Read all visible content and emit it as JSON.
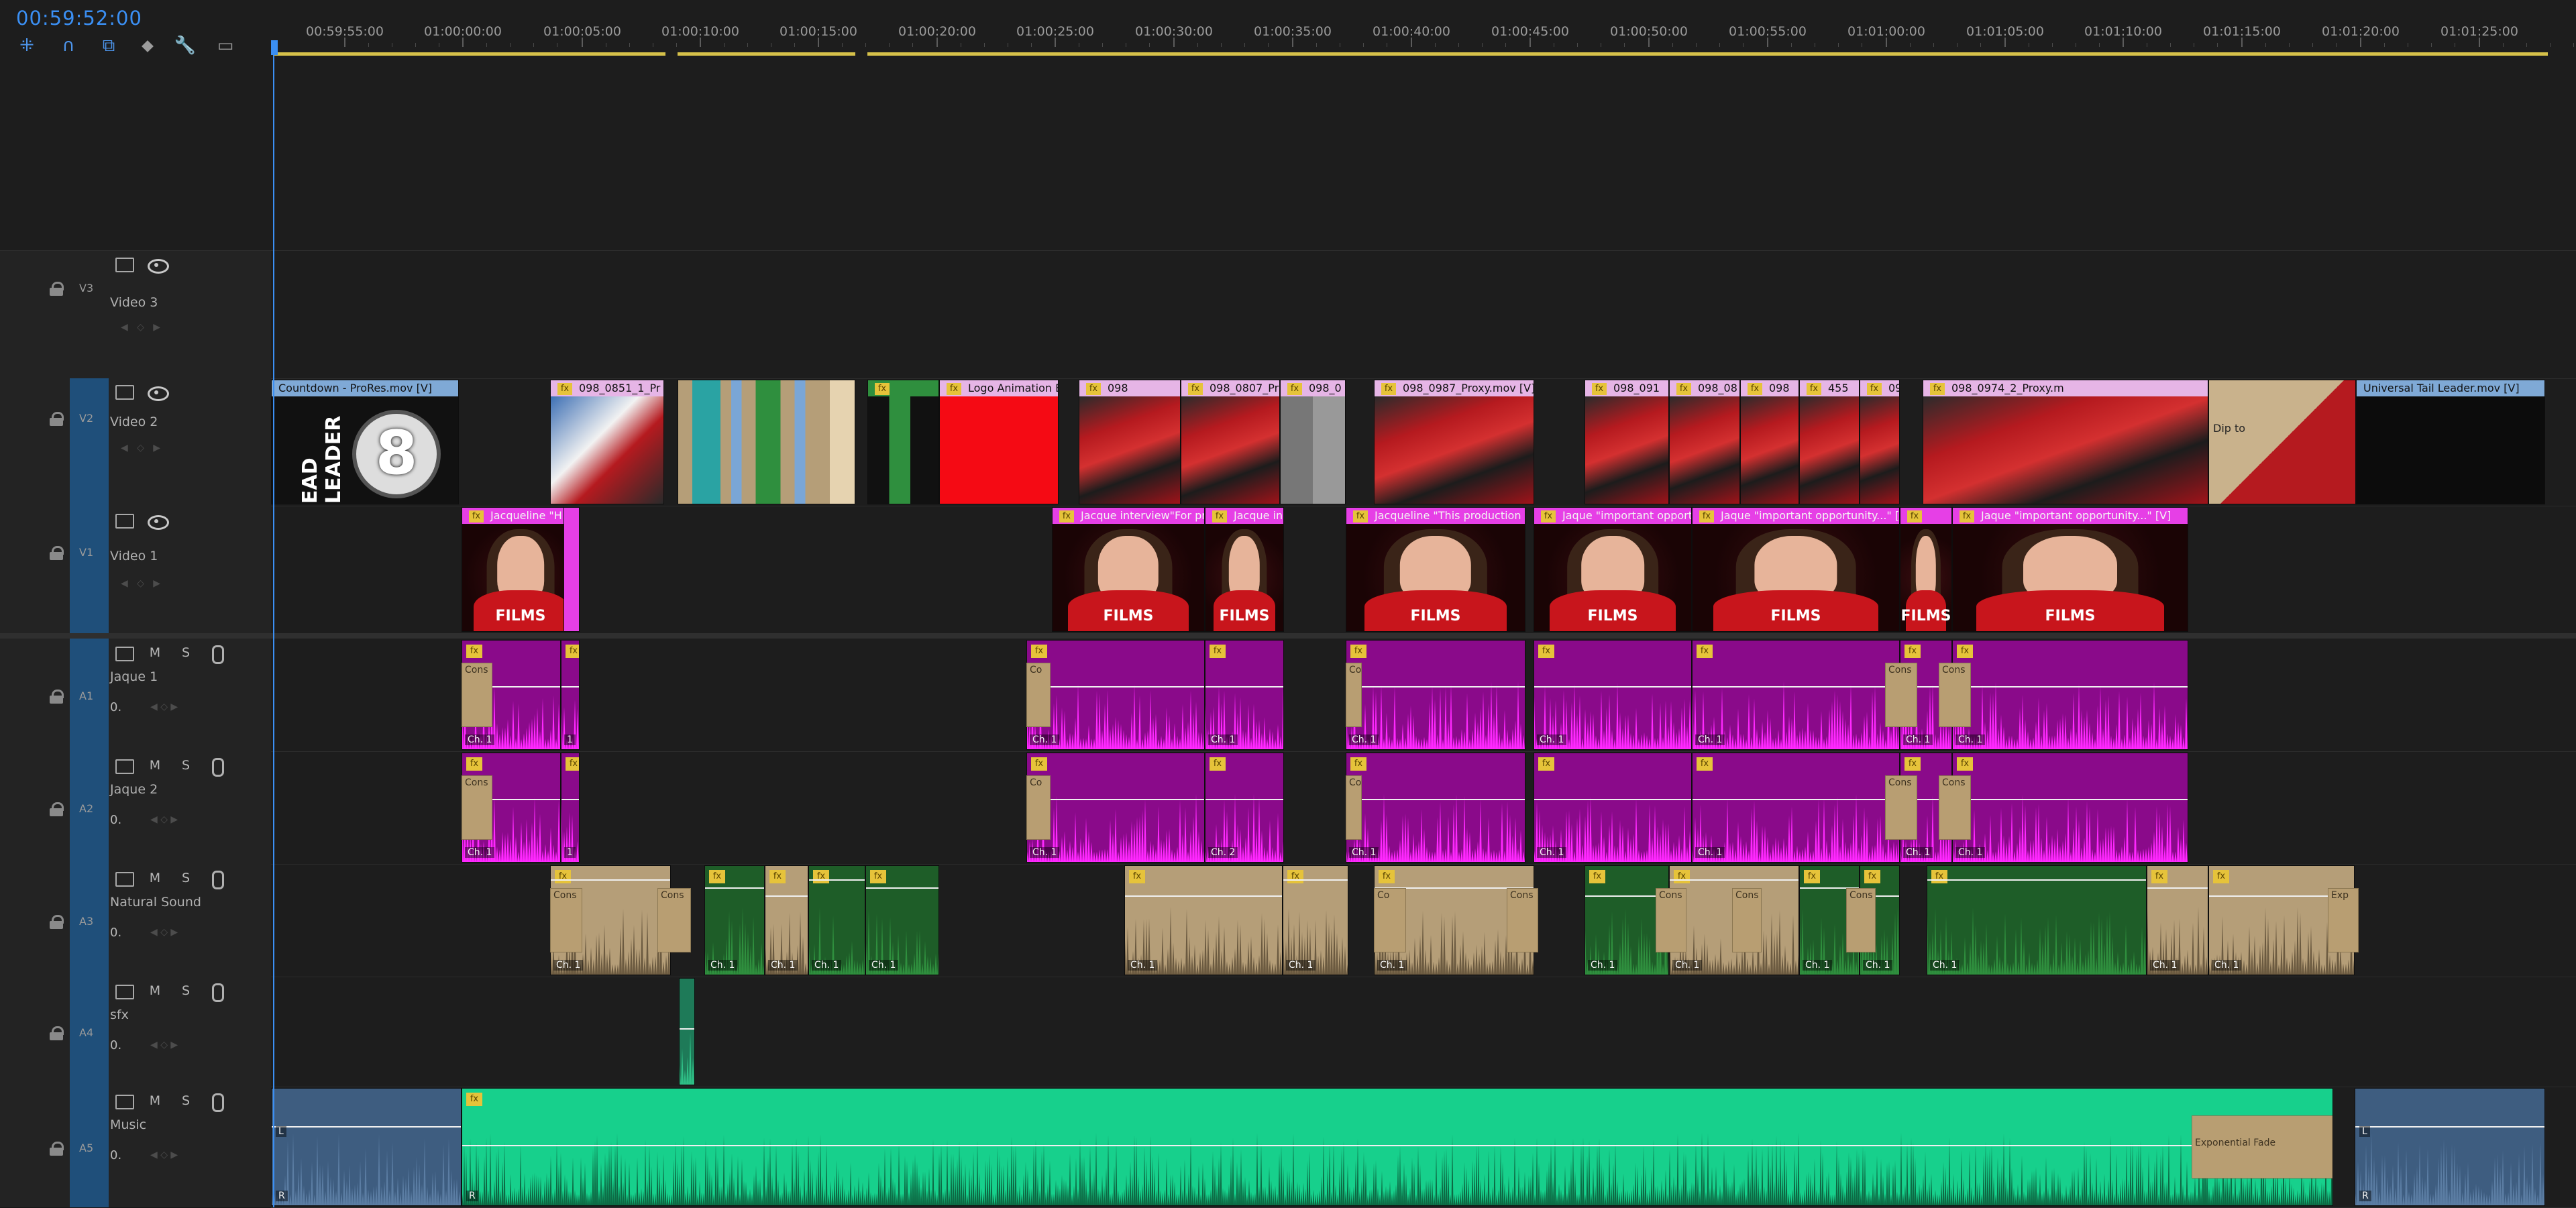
{
  "timeline": {
    "timecode": "00:59:52:00",
    "ruler": {
      "labels": [
        "00:59:55:00",
        "01:00:00:00",
        "01:00:05:00",
        "01:00:10:00",
        "01:00:15:00",
        "01:00:20:00",
        "01:00:25:00",
        "01:00:30:00",
        "01:00:35:00",
        "01:00:40:00",
        "01:00:45:00",
        "01:00:50:00",
        "01:00:55:00",
        "01:01:00:00",
        "01:01:05:00",
        "01:01:10:00",
        "01:01:15:00",
        "01:01:20:00",
        "01:01:25:00"
      ]
    },
    "tools": [
      {
        "name": "snap-icon",
        "glyph": "⁜"
      },
      {
        "name": "magnet-icon",
        "glyph": "∩"
      },
      {
        "name": "linked-selection-icon",
        "glyph": "⧉"
      },
      {
        "name": "marker-icon",
        "glyph": "⬥"
      },
      {
        "name": "wrench-icon",
        "glyph": "🔧"
      },
      {
        "name": "captions-icon",
        "glyph": "▭"
      }
    ]
  },
  "tracks": {
    "video": [
      {
        "id": "V3",
        "name": "Video 3"
      },
      {
        "id": "V2",
        "name": "Video 2"
      },
      {
        "id": "V1",
        "name": "Video 1"
      }
    ],
    "audio": [
      {
        "id": "A1",
        "name": "Jaque 1",
        "m": "M",
        "s": "S",
        "vol": "0."
      },
      {
        "id": "A2",
        "name": "Jaque 2",
        "m": "M",
        "s": "S",
        "vol": "0."
      },
      {
        "id": "A3",
        "name": "Natural Sound",
        "m": "M",
        "s": "S",
        "vol": "0."
      },
      {
        "id": "A4",
        "name": "sfx",
        "m": "M",
        "s": "S",
        "vol": "0."
      },
      {
        "id": "A5",
        "name": "Music",
        "m": "M",
        "s": "S",
        "vol": "0."
      }
    ]
  },
  "clips": {
    "v2": [
      {
        "label": "Countdown - ProRes.mov [V]",
        "color": "#7fa9d6",
        "fx": false,
        "thumb": "leader",
        "thumb_text": "8",
        "leader_text": "EAD LEADER"
      },
      {
        "label": "098_0851_1_Pr",
        "color": "#e6b5e6",
        "fx": true,
        "thumb": "red"
      },
      {
        "label": "",
        "color": "#2aa3a3",
        "fx": false,
        "thumb": "stripes"
      },
      {
        "label": "",
        "color": "#2f8f3e",
        "fx": true,
        "thumb": "green"
      },
      {
        "label": "Logo Animation E",
        "color": "#e6b5e6",
        "fx": true,
        "thumb": "redblock"
      },
      {
        "label": "098",
        "color": "#e6b5e6",
        "fx": true,
        "thumb": "crowd"
      },
      {
        "label": "098_0807_Pr",
        "color": "#e6b5e6",
        "fx": true,
        "thumb": "crowd"
      },
      {
        "label": "098_0",
        "color": "#e6b5e6",
        "fx": true,
        "thumb": "grey"
      },
      {
        "label": "098_0987_Proxy.mov [V]",
        "color": "#e6b5e6",
        "fx": true,
        "thumb": "crowd"
      },
      {
        "label": "098_091",
        "color": "#e6b5e6",
        "fx": true,
        "thumb": "crowd"
      },
      {
        "label": "098_08",
        "color": "#e6b5e6",
        "fx": true,
        "thumb": "crowd"
      },
      {
        "label": "098",
        "color": "#e6b5e6",
        "fx": true,
        "thumb": "crowd"
      },
      {
        "label": "455",
        "color": "#e6b5e6",
        "fx": true,
        "thumb": "crowd"
      },
      {
        "label": "098_",
        "color": "#e6b5e6",
        "fx": true,
        "thumb": "crowd"
      },
      {
        "label": "098_0974_2_Proxy.m",
        "color": "#e6b5e6",
        "fx": true,
        "thumb": "crowd"
      },
      {
        "label": "Dip to",
        "color": "#e6b5e6",
        "fx": false,
        "thumb": "dip"
      },
      {
        "label": "Universal Tail Leader.mov [V]",
        "color": "#7fa9d6",
        "fx": false,
        "thumb": "dark"
      }
    ],
    "v1": [
      {
        "label": "Jacqueline \"H"
      },
      {
        "label": "Jacque interview\"For pr"
      },
      {
        "label": "Jacque in"
      },
      {
        "label": "Jacqueline \"This production is"
      },
      {
        "label": "Jaque \"important opport"
      },
      {
        "label": "Jaque \"important opportunity...\" [V]"
      },
      {
        "label": ""
      },
      {
        "label": "Jaque \"important opportunity...\" [V]"
      }
    ],
    "v1_logo": "FILMS",
    "audio_channel": "Ch. 1",
    "audio_channel_short": "1",
    "audio_channel_2": "Ch. 2",
    "transition_short": "Cons",
    "transition_short_cut": "Co",
    "transition_a3_exp": "Exp",
    "music_fade": "Exponential Fade",
    "music_r": "R",
    "music_l": "L"
  },
  "colors": {
    "accent": "#3b8ff3",
    "v1_clip": "#e63fe6",
    "a1_clip": "#e63fe6",
    "a3_clip": "#b59e78",
    "a3_green": "#2f8f3e",
    "music_clip": "#17d08c",
    "music_blue": "#3e5d80",
    "work_area": "#d6c14a"
  }
}
